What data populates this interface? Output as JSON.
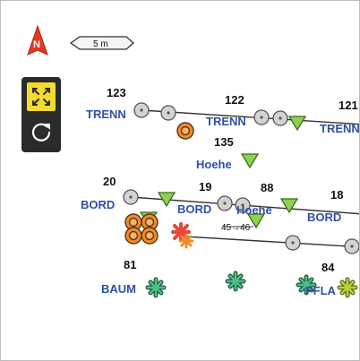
{
  "scale": {
    "label": "5 m"
  },
  "compass": {
    "label": "N",
    "color": "#e53a1c"
  },
  "tools": {
    "fit_icon": "fit-extent-icon",
    "refresh_icon": "refresh-icon",
    "accent": "#f2dc2f"
  },
  "points": {
    "p123": "123",
    "p122": "122",
    "p121": "121",
    "p135": "135",
    "p20": "20",
    "p19": "19",
    "p88": "88",
    "p18": "18",
    "p81": "81",
    "p84": "84"
  },
  "codes": {
    "trenn_a": "TRENN",
    "trenn_b": "TRENN",
    "trenn_c": "TRENN",
    "hoehe_a": "Hoehe",
    "hoehe_b": "Hoehe",
    "bord_a": "BORD",
    "bord_b": "BORD",
    "bord_c": "BORD",
    "baum": "BAUM",
    "pfla": "PFLA"
  },
  "measure": {
    "label": "45→46"
  },
  "colors": {
    "label_blue": "#2f4fa8",
    "triangle": "#8fd14f",
    "tree": "#2e9e6a",
    "cluster": "#f08c28",
    "red_star": "#e8463a"
  }
}
